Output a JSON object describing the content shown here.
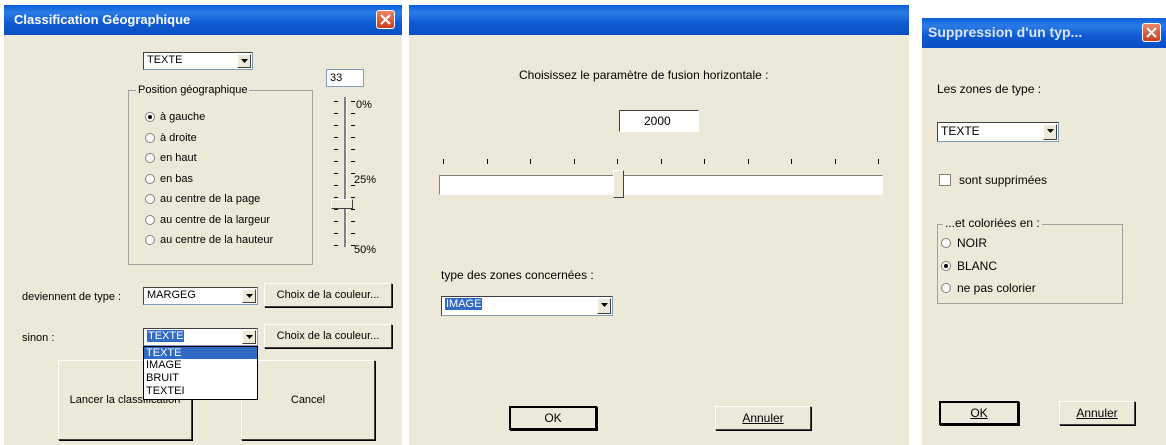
{
  "dialog1": {
    "title": "Classification Géographique",
    "top_combo": "TEXTE",
    "value_box": "33",
    "group_label": "Position géographique",
    "radios": [
      "à gauche",
      "à droite",
      "en haut",
      "en bas",
      "au centre de la page",
      "au centre de la largeur",
      "au centre de la hauteur"
    ],
    "selected_radio": 0,
    "scale_labels": [
      "0%",
      "25%",
      "50%"
    ],
    "slider_value_percent": 33,
    "become_label": "deviennent de type :",
    "become_combo": "MARGEG",
    "color_button_1": "Choix de la couleur...",
    "else_label": "sinon :",
    "else_combo": "TEXTE",
    "color_button_2": "Choix de la couleur...",
    "dropdown_options": [
      "TEXTE",
      "IMAGE",
      "BRUIT",
      "TEXTEI"
    ],
    "dropdown_selected": 0,
    "launch_button": "Lancer la classification",
    "cancel_button": "Cancel"
  },
  "dialog2": {
    "prompt": "Choisissez le paramètre de fusion horizontale :",
    "value": "2000",
    "slider_value_fraction": 0.4,
    "zone_label": "type des zones concernées :",
    "zone_combo": "IMAGE",
    "ok_button": "OK",
    "cancel_button": "Annuler"
  },
  "dialog3": {
    "title": "Suppression d'un typ...",
    "zones_label": "Les zones de type :",
    "zone_combo": "TEXTE",
    "deleted_label": "sont supprimées",
    "deleted_checked": false,
    "group_label": "...et coloriées en :",
    "radios": [
      "NOIR",
      "BLANC",
      "ne pas colorier"
    ],
    "selected_radio": 1,
    "ok_button": "OK",
    "cancel_button": "Annuler"
  },
  "colors": {
    "title_blue": "#0a5fd8",
    "dialog_face": "#ece9d8",
    "selection": "#316ac5",
    "close_red": "#d4512e"
  }
}
